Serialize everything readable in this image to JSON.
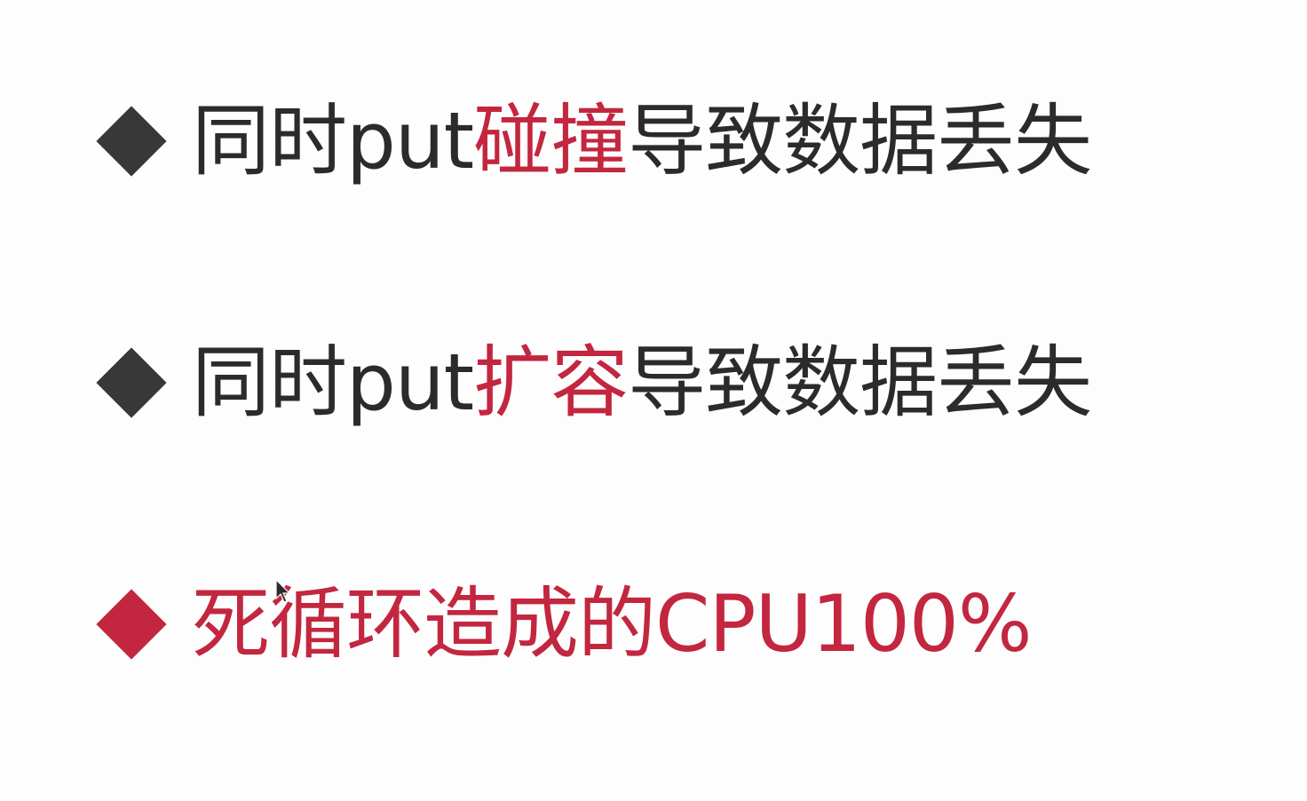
{
  "colors": {
    "text_dark": "#2b2b2b",
    "accent_red": "#c3263f",
    "bullet_dark": "#383838"
  },
  "bullets": [
    {
      "prefix": "同时put",
      "highlight": "碰撞",
      "suffix": "导致数据丢失",
      "bullet_icon": "diamond-dark-icon"
    },
    {
      "prefix": "同时put",
      "highlight": "扩容",
      "suffix": "导致数据丢失",
      "bullet_icon": "diamond-dark-icon"
    },
    {
      "text": "死循环造成的CPU100%",
      "bullet_icon": "diamond-red-icon"
    }
  ],
  "cursor_icon": "mouse-pointer-icon"
}
